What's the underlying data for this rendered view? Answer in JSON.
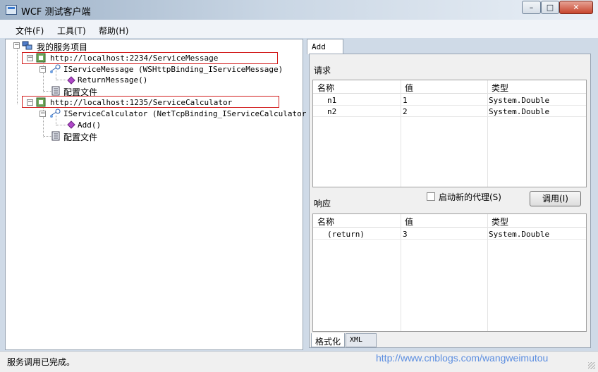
{
  "window": {
    "title": "WCF 测试客户端",
    "minimize_glyph": "–",
    "maximize_glyph": "□",
    "close_glyph": "✕"
  },
  "menu": [
    {
      "label": "文件(F)"
    },
    {
      "label": "工具(T)"
    },
    {
      "label": "帮助(H)"
    }
  ],
  "tree": {
    "root": "我的服务项目",
    "services": [
      {
        "url": "http://localhost:2234/ServiceMessage",
        "contract": "IServiceMessage (WSHttpBinding_IServiceMessage)",
        "operation": "ReturnMessage()",
        "config": "配置文件"
      },
      {
        "url": "http://localhost:1235/ServiceCalculator",
        "contract": "IServiceCalculator (NetTcpBinding_IServiceCalculator)",
        "operation": "Add()",
        "config": "配置文件"
      }
    ]
  },
  "right": {
    "tab": "Add",
    "request_label": "请求",
    "columns": [
      "名称",
      "值",
      "类型"
    ],
    "request_rows": [
      {
        "name": "n1",
        "value": "1",
        "type": "System.Double"
      },
      {
        "name": "n2",
        "value": "2",
        "type": "System.Double"
      }
    ],
    "response_label": "响应",
    "new_proxy_label": "启动新的代理(S)",
    "new_proxy_checked": false,
    "invoke_label": "调用(I)",
    "response_rows": [
      {
        "name": "(return)",
        "value": "3",
        "type": "System.Double"
      }
    ],
    "bottom_tabs": [
      {
        "label": "格式化",
        "active": true
      },
      {
        "label": "XML",
        "active": false
      }
    ]
  },
  "status": {
    "text": "服务调用已完成。",
    "watermark": "http://www.cnblogs.com/wangweimutou"
  },
  "colors": {
    "highlight_box": "#d21d1d",
    "operation_icon": "#b048c8",
    "watermark": "#5c8ee0"
  }
}
